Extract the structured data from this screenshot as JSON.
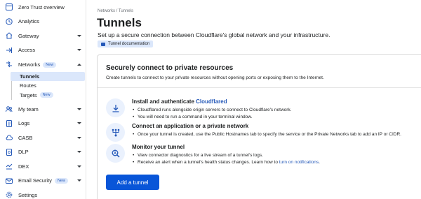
{
  "sidebar": {
    "items": [
      {
        "label": "Zero Trust overview",
        "icon": "grid-icon"
      },
      {
        "label": "Analytics",
        "icon": "clock-icon"
      },
      {
        "label": "Gateway",
        "icon": "gateway-icon"
      },
      {
        "label": "Access",
        "icon": "access-icon"
      },
      {
        "label": "Networks",
        "badge": "New",
        "icon": "networks-icon"
      },
      {
        "label": "My team",
        "icon": "team-icon"
      },
      {
        "label": "Logs",
        "icon": "logs-icon"
      },
      {
        "label": "CASB",
        "icon": "casb-icon"
      },
      {
        "label": "DLP",
        "icon": "dlp-icon"
      },
      {
        "label": "DEX",
        "icon": "dex-icon"
      },
      {
        "label": "Email Security",
        "badge": "New",
        "icon": "email-icon"
      },
      {
        "label": "Settings",
        "icon": "settings-icon"
      }
    ],
    "networks_sub": [
      {
        "label": "Tunnels"
      },
      {
        "label": "Routes"
      },
      {
        "label": "Targets",
        "badge": "New"
      }
    ]
  },
  "header": {
    "breadcrumb": "Networks  /  Tunnels",
    "title": "Tunnels",
    "description": "Set up a secure connection between Cloudflare's global network and your infrastructure.",
    "doc_link": "Tunnel documentation"
  },
  "card": {
    "title": "Securely connect to private resources",
    "description": "Create tunnels to connect to your private resources without opening ports or exposing them to the Internet.",
    "steps": [
      {
        "title": "Install and authenticate ",
        "title_link": "Cloudflared",
        "bullets": [
          "Cloudflared runs alongside origin servers to connect to Cloudflare's network.",
          "You will need to run a command in your terminal window."
        ]
      },
      {
        "title": "Connect an application or a private network",
        "bullets": [
          "Once your tunnel is created, use the Public Hostnames tab to specify the service or the Private Networks tab to add an IP or CIDR."
        ]
      },
      {
        "title": "Monitor your tunnel",
        "bullets": [
          "View connector diagnostics for a live stream of a tunnel's logs.",
          "Receive an alert when a tunnel's health status changes. Learn how to "
        ],
        "bullet_link": "turn on notifications",
        "bullet_link_suffix": "."
      }
    ],
    "button": "Add a tunnel"
  },
  "colors": {
    "accent": "#0855d8",
    "link": "#2458b8",
    "highlight": "#dbe7fb"
  }
}
